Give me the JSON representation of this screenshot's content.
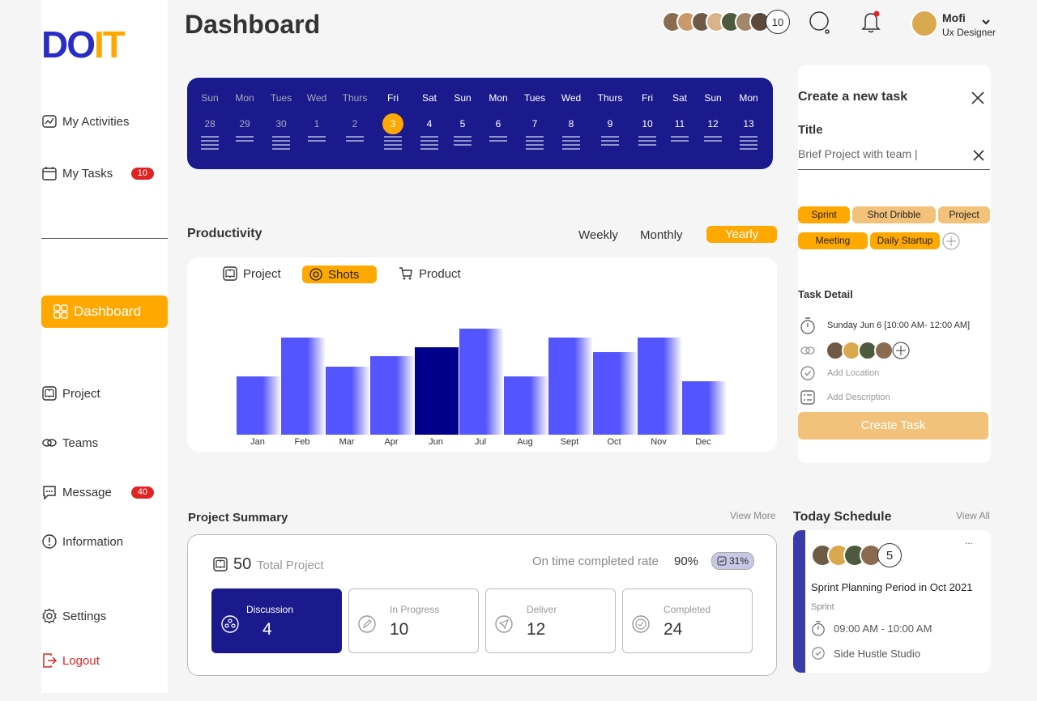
{
  "sidebar": {
    "logo": {
      "part1": "DO",
      "part2": "IT"
    },
    "items": [
      {
        "label": "My Activities",
        "icon": "activity-icon"
      },
      {
        "label": "My Tasks",
        "icon": "calendar-icon",
        "badge": "10"
      },
      {
        "label": "Dashboard",
        "icon": "grid-icon",
        "active": true
      },
      {
        "label": "Project",
        "icon": "book-icon"
      },
      {
        "label": "Teams",
        "icon": "link-icon"
      },
      {
        "label": "Message",
        "icon": "chat-icon",
        "badge": "40"
      },
      {
        "label": "Information",
        "icon": "info-icon"
      },
      {
        "label": "Settings",
        "icon": "gear-icon"
      },
      {
        "label": "Logout",
        "icon": "logout-icon"
      }
    ]
  },
  "header": {
    "title": "Dashboard",
    "members_count": "10",
    "profile": {
      "name": "Mofi",
      "role": "Ux Designer"
    }
  },
  "calendar": [
    {
      "day": "Sun",
      "date": "28",
      "lines": 4,
      "dim": true
    },
    {
      "day": "Mon",
      "date": "29",
      "lines": 2,
      "dim": true
    },
    {
      "day": "Tues",
      "date": "30",
      "lines": 4,
      "dim": true
    },
    {
      "day": "Wed",
      "date": "1",
      "lines": 2,
      "dim": true
    },
    {
      "day": "Thurs",
      "date": "2",
      "lines": 2,
      "dim": true
    },
    {
      "day": "Fri",
      "date": "3",
      "lines": 4,
      "selected": true
    },
    {
      "day": "Sat",
      "date": "4",
      "lines": 4
    },
    {
      "day": "Sun",
      "date": "5",
      "lines": 3
    },
    {
      "day": "Mon",
      "date": "6",
      "lines": 2
    },
    {
      "day": "Tues",
      "date": "7",
      "lines": 4
    },
    {
      "day": "Wed",
      "date": "8",
      "lines": 4
    },
    {
      "day": "Thurs",
      "date": "9",
      "lines": 3
    },
    {
      "day": "Fri",
      "date": "10",
      "lines": 3
    },
    {
      "day": "Sat",
      "date": "11",
      "lines": 2
    },
    {
      "day": "Sun",
      "date": "12",
      "lines": 2
    },
    {
      "day": "Mon",
      "date": "13",
      "lines": 4
    }
  ],
  "productivity": {
    "title": "Productivity",
    "periods": [
      "Weekly",
      "Monthly",
      "Yearly"
    ],
    "active_period": "Yearly",
    "filters": [
      "Project",
      "Shots",
      "Product"
    ],
    "active_filter": "Shots"
  },
  "chart_data": {
    "type": "bar",
    "categories": [
      "Jan",
      "Feb",
      "Mar",
      "Apr",
      "Jun",
      "Jul",
      "Aug",
      "Sept",
      "Oct",
      "Nov",
      "Dec"
    ],
    "values": [
      72,
      120,
      84,
      97,
      108,
      131,
      72,
      120,
      102,
      120,
      66
    ],
    "highlight_index": 4,
    "colors": {
      "bar": "#5555ff",
      "highlight": "#00008b"
    }
  },
  "summary": {
    "title": "Project Summary",
    "view_more": "View More",
    "total_count": "50",
    "total_label": "Total Project",
    "rate_label": "On time completed rate",
    "rate_value": "90%",
    "trend": "31%",
    "stats": [
      {
        "label": "Discussion",
        "value": "4",
        "icon": "people-icon",
        "active": true
      },
      {
        "label": "In Progress",
        "value": "10",
        "icon": "edit-icon"
      },
      {
        "label": "Deliver",
        "value": "12",
        "icon": "send-icon"
      },
      {
        "label": "Completed",
        "value": "24",
        "icon": "check-icon"
      }
    ]
  },
  "task_panel": {
    "heading": "Create a new task",
    "title_label": "Title",
    "title_value": "Brief Project with team |",
    "tags": [
      "Sprint",
      "Shot Dribble",
      "Project",
      "Meeting",
      "Daily Startup"
    ],
    "detail_heading": "Task Detail",
    "time": "Sunday Jun 6 [10:00 AM- 12:00 AM]",
    "location_placeholder": "Add Location",
    "description_placeholder": "Add Description",
    "submit": "Create Task"
  },
  "schedule": {
    "title": "Today Schedule",
    "view_all": "View All",
    "more": "...",
    "members_count": "5",
    "event_title": "Sprint Planning Period in Oct 2021",
    "event_type": "Sprint",
    "event_time": "09:00 AM - 10:00 AM",
    "event_place": "Side Hustle Studio"
  }
}
